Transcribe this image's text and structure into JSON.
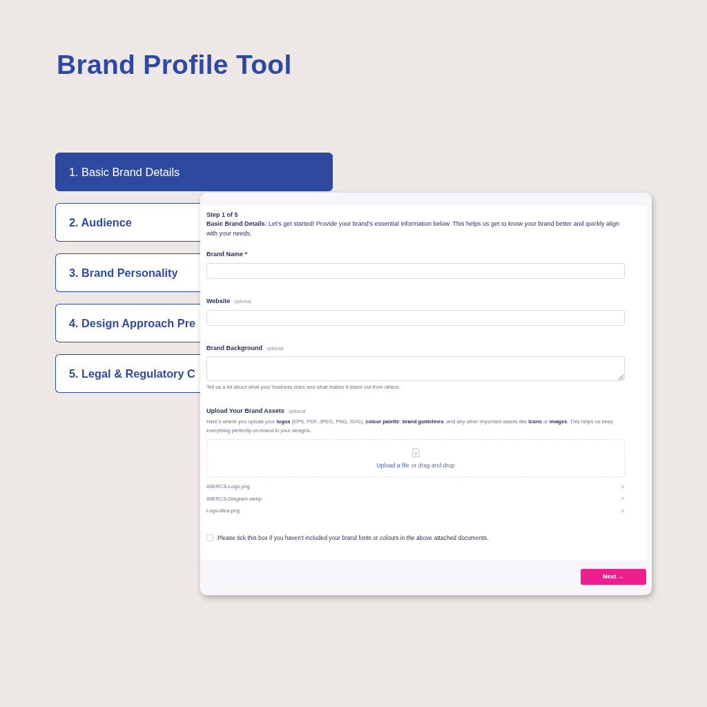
{
  "title": "Brand Profile Tool",
  "steps": [
    {
      "label": "1. Basic Brand Details",
      "selected": true
    },
    {
      "label": "2. Audience",
      "selected": false
    },
    {
      "label": "3. Brand Personality",
      "selected": false
    },
    {
      "label": "4. Design Approach Pre",
      "selected": false
    },
    {
      "label": "5. Legal & Regulatory C",
      "selected": false
    }
  ],
  "form": {
    "step": "Step 1 of 5",
    "intro": "**Basic Brand Details:** Let's get started! Provide your brand's essential information below. This helps us get to know your brand better and quickly align with your needs.",
    "fields": [
      {
        "kind": "input",
        "label": "Brand Name *"
      },
      {
        "kind": "input",
        "label": "Website",
        "tag": "optional"
      },
      {
        "kind": "textarea",
        "label": "Brand Background",
        "tag": "optional",
        "hint": "Tell us a bit about what your business does and what makes it stand out from others."
      }
    ],
    "upload": {
      "label": "Upload Your Brand Assets",
      "tag": "optional",
      "description": "Here's where you upload your **logos** (EPS, PDF, JPEG, PNG, SVG), **colour palette**, **brand guidelines**, and any other important assets like **icons** or **images**. This helps us keep everything perfectly on-brand in your designs.",
      "link": "Upload a file",
      "rest": "or drag and drop",
      "files": [
        "IMERCS-Logo.png",
        "IMERCS-Diagram.webp",
        "Logo-idea.png"
      ]
    },
    "checkbox": {
      "label": "Please tick this box if you haven't included your brand fonts or colours in the above attached documents.",
      "checked": false
    },
    "next_button": "Next →"
  }
}
